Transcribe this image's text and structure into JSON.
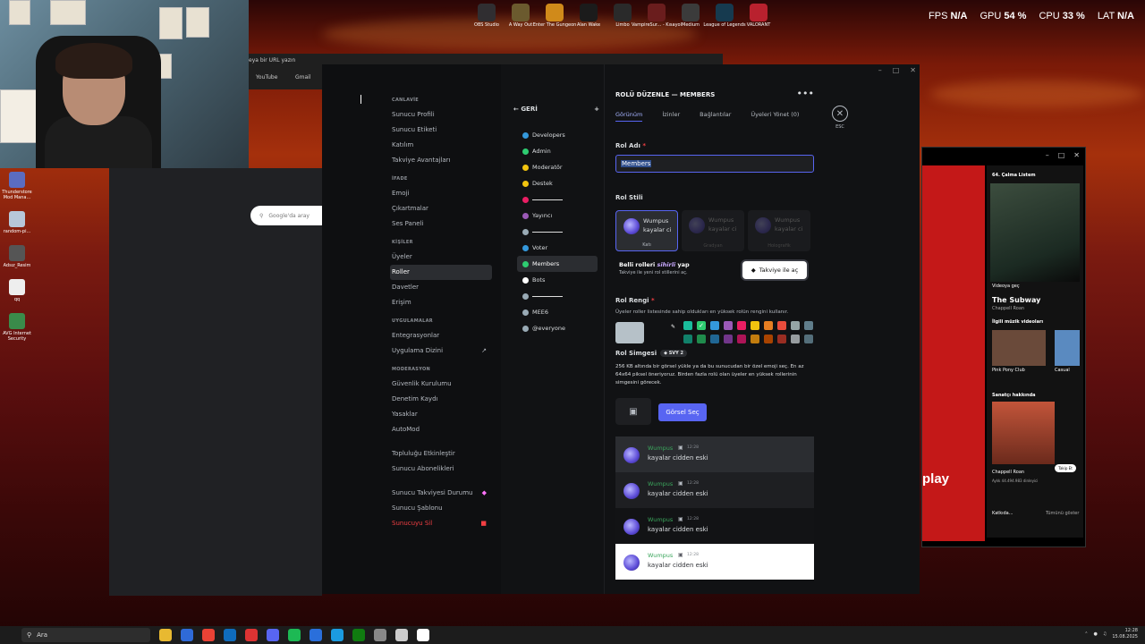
{
  "overlay": {
    "apps": [
      {
        "label": "OBS Studio",
        "icon": "obs-icon",
        "color": "#302e31"
      },
      {
        "label": "A Way Out",
        "icon": "game-icon",
        "color": "#6b5a2e"
      },
      {
        "label": "Enter The Gungeon",
        "icon": "game-icon",
        "color": "#d08a1a"
      },
      {
        "label": "Alan Wake",
        "icon": "game-icon",
        "color": "#1b1b1b"
      },
      {
        "label": "Limbo",
        "icon": "game-icon",
        "color": "#2a2a2a"
      },
      {
        "label": "VampireSur... - Kısayol",
        "icon": "game-icon",
        "color": "#6a1d1d"
      },
      {
        "label": "Medium",
        "icon": "game-icon",
        "color": "#3b3b3b"
      },
      {
        "label": "League of Legends",
        "icon": "lol-icon",
        "color": "#163a4f"
      },
      {
        "label": "VALORANT",
        "icon": "valorant-icon",
        "color": "#b9212e"
      }
    ],
    "perf": [
      {
        "label": "FPS",
        "value": "N/A"
      },
      {
        "label": "GPU",
        "value": "54 %"
      },
      {
        "label": "CPU",
        "value": "33 %"
      },
      {
        "label": "LAT",
        "value": "N/A"
      }
    ]
  },
  "browser": {
    "url_placeholder": "eya bir URL yazın",
    "bookmarks": [
      "YouTube",
      "Gmail"
    ],
    "google_search": "Google'da aray"
  },
  "desktop_icons": [
    "Thunderstore Mod Mana...",
    "random-pi...",
    "Adsız_Resim",
    "qq",
    "AVG Internet Security"
  ],
  "settings_nav": {
    "sections": [
      {
        "title": "CANLAVİE",
        "items": [
          "Sunucu Profili",
          "Sunucu Etiketi",
          "Katılım",
          "Takviye Avantajları"
        ]
      },
      {
        "title": "İFADE",
        "items": [
          "Emoji",
          "Çıkartmalar",
          "Ses Paneli"
        ]
      },
      {
        "title": "KİŞİLER",
        "items": [
          "Üyeler",
          "Roller",
          "Davetler",
          "Erişim"
        ]
      },
      {
        "title": "UYGULAMALAR",
        "items": [
          "Entegrasyonlar",
          "Uygulama Dizini"
        ]
      },
      {
        "title": "MODERASYON",
        "items": [
          "Güvenlik Kurulumu",
          "Denetim Kaydı",
          "Yasaklar",
          "AutoMod"
        ]
      },
      {
        "title": "",
        "items": [
          "Topluluğu Etkinleştir",
          "Sunucu Abonelikleri"
        ]
      },
      {
        "title": "",
        "items": [
          "Sunucu Takviyesi Durumu",
          "Sunucu Şablonu",
          "Sunucuyu Sil"
        ]
      }
    ],
    "active": "Roller",
    "danger": "Sunucuyu Sil"
  },
  "roles": {
    "back_label": "GERİ",
    "add_icon": "plus-icon",
    "list": [
      {
        "name": "Developers",
        "color": "#3498db"
      },
      {
        "name": "Admin",
        "color": "#2ecc71"
      },
      {
        "name": "Moderatör",
        "color": "#f1c40f"
      },
      {
        "name": "Destek",
        "color": "#f1c40f"
      },
      {
        "name": "",
        "color": "#e91e63",
        "line": true
      },
      {
        "name": "Yayıncı",
        "color": "#9b59b6"
      },
      {
        "name": "",
        "color": "#99aab5",
        "line": true
      },
      {
        "name": "Voter",
        "color": "#3498db"
      },
      {
        "name": "Members",
        "color": "#2ecc71"
      },
      {
        "name": "Bots",
        "color": "#ffffff"
      },
      {
        "name": "",
        "color": "#99aab5",
        "line": true
      },
      {
        "name": "MEE6",
        "color": "#99aab5"
      },
      {
        "name": "@everyone",
        "color": "#99aab5"
      }
    ],
    "active": "Members"
  },
  "editor": {
    "title": "ROLÜ DÜZENLE — MEMBERS",
    "tabs": [
      "Görünüm",
      "İzinler",
      "Bağlantılar",
      "Üyeleri Yönet (0)"
    ],
    "esc": "ESC",
    "role_name_label": "Rol Adı",
    "role_name_value": "Members",
    "role_style_label": "Rol Stili",
    "style_cards": [
      {
        "preview": "Wumpus kayalar ci",
        "caption": "Katı"
      },
      {
        "preview": "Wumpus kayalar ci",
        "caption": "Gradyan"
      },
      {
        "preview": "Wumpus kayalar ci",
        "caption": "Holografik"
      }
    ],
    "boost_title_a": "Belli rolleri ",
    "boost_title_b": "sihirli",
    "boost_title_c": " yap",
    "boost_sub": "Takviye ile yeni rol stillerini aç.",
    "boost_button": "Takviye ile aç",
    "color_label": "Rol Rengi",
    "color_desc": "Üyeler roller listesinde sahip oldukları en yüksek rolün rengini kullanır.",
    "swatches": [
      "#1abc9c",
      "#2ecc71",
      "#3498db",
      "#9b59b6",
      "#e91e63",
      "#f1c40f",
      "#e67e22",
      "#e74c3c",
      "#95a5a6",
      "#607d8b",
      "#11806a",
      "#1f8b4c",
      "#206694",
      "#71368a",
      "#ad1457",
      "#c27c0e",
      "#a84300",
      "#992d22",
      "#979c9f",
      "#546e7a"
    ],
    "selected_swatch": 1,
    "icon_label": "Rol Simgesi",
    "icon_level": "SVY 2",
    "icon_desc": "256 KB altında bir görsel yükle ya da bu sunucudan bir özel emoji seç. En az 64x64 piksel öneriyoruz. Birden fazla rolü olan üyeler en yüksek rollerinin simgesini görecek.",
    "pick_button": "Görsel Seç",
    "previews": [
      {
        "name": "Wumpus",
        "time": "12:28",
        "message": "kayalar cidden eski"
      },
      {
        "name": "Wumpus",
        "time": "12:28",
        "message": "kayalar cidden eski"
      },
      {
        "name": "Wumpus",
        "time": "12:28",
        "message": "kayalar cidden eski"
      },
      {
        "name": "Wumpus",
        "time": "12:28",
        "message": "kayalar cidden eski"
      }
    ]
  },
  "music": {
    "playlist": "64. Çalma Listem",
    "video": "Videoya geç",
    "track": "The Subway",
    "artist": "Chappell Roan",
    "related": "İlgili müzik videoları",
    "rel1": "Pink Pony Club",
    "rel2": "Casual",
    "about": "Sanatçı hakkında",
    "about_name": "Chappell Roan",
    "listeners": "Aylık 44.494.983 dinleyici",
    "follow": "Takip Et",
    "play_text": "play",
    "credits": "Katkıda...",
    "show_all": "Tümünü göster"
  },
  "taskbar": {
    "search": "Ara",
    "time": "12:28",
    "date": "15.08.2025",
    "icons": [
      "#e8b931",
      "#2f6ad8",
      "#e94235",
      "#0f6cbd",
      "#d33",
      "#5865f2",
      "#1db954",
      "#2a6fdb",
      "#1b9be0",
      "#107c10",
      "#888",
      "#ccc",
      "#fff"
    ]
  }
}
